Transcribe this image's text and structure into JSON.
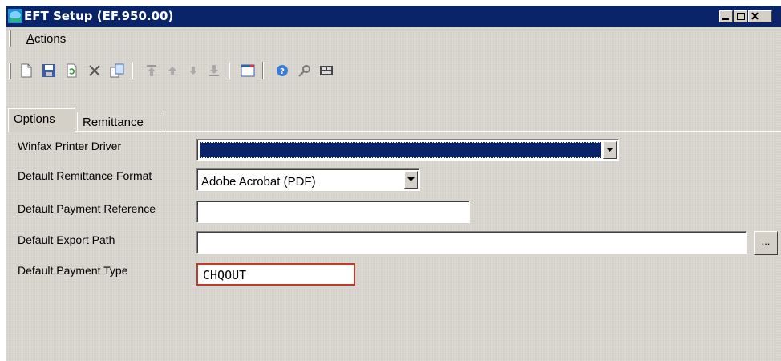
{
  "window": {
    "title": "EFT Setup (EF.950.00)"
  },
  "menu": {
    "actions_label": "Actions",
    "actions_mnemonic": "A",
    "actions_rest": "ctions"
  },
  "toolbar": {
    "icons": [
      "new-icon",
      "save-icon",
      "refresh-icon",
      "delete-icon",
      "copy-icon",
      "first-icon",
      "previous-icon",
      "next-icon",
      "last-icon",
      "notes-icon",
      "help-icon",
      "customize-icon",
      "report-icon"
    ]
  },
  "tabs": [
    {
      "label": "Options",
      "active": true
    },
    {
      "label": "Remittance",
      "active": false
    }
  ],
  "form": {
    "winfax": {
      "label": "Winfax Printer Driver",
      "value": ""
    },
    "remittance_format": {
      "label": "Default Remittance Format",
      "value": "Adobe Acrobat (PDF)"
    },
    "payment_reference": {
      "label": "Default Payment Reference",
      "value": ""
    },
    "export_path": {
      "label": "Default Export Path",
      "value": "",
      "browse_label": "..."
    },
    "payment_type": {
      "label": "Default Payment Type",
      "value": "CHQOUT"
    }
  },
  "colors": {
    "titlebar": "#0a246a",
    "face": "#d4d0c8",
    "error_border": "#c0392b"
  }
}
